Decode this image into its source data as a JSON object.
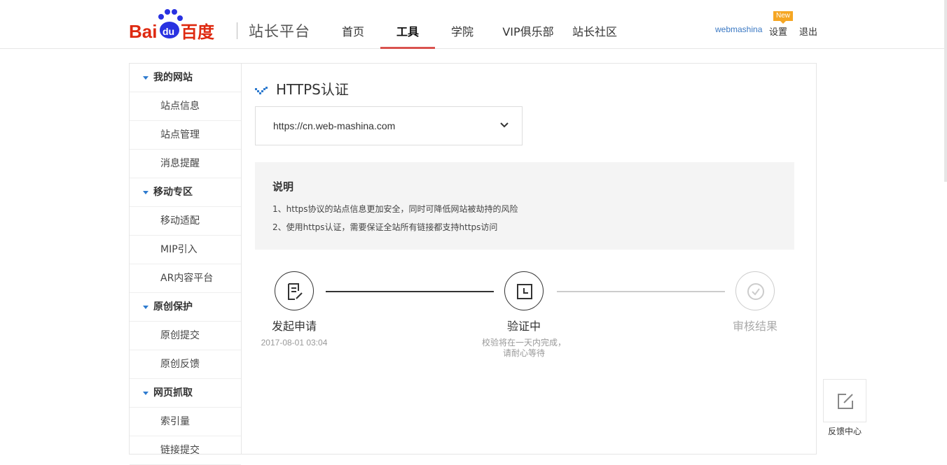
{
  "header": {
    "logo_text": "Bai du 百度",
    "site_title": "站长平台",
    "nav": [
      {
        "label": "首页",
        "active": false
      },
      {
        "label": "工具",
        "active": true
      },
      {
        "label": "学院",
        "active": false
      },
      {
        "label": "VIP俱乐部",
        "active": false
      },
      {
        "label": "站长社区",
        "active": false
      }
    ],
    "username": "webmashina",
    "settings_label": "设置",
    "new_badge": "New",
    "logout_label": "退出"
  },
  "sidebar": {
    "groups": [
      {
        "label": "我的网站",
        "items": [
          "站点信息",
          "站点管理",
          "消息提醒"
        ]
      },
      {
        "label": "移动专区",
        "items": [
          "移动适配",
          "MIP引入",
          "AR内容平台"
        ]
      },
      {
        "label": "原创保护",
        "items": [
          "原创提交",
          "原创反馈"
        ]
      },
      {
        "label": "网页抓取",
        "items": [
          "索引量",
          "链接提交"
        ]
      }
    ]
  },
  "main": {
    "title": "HTTPS认证",
    "site_select": {
      "value": "https://cn.web-mashina.com"
    },
    "note": {
      "title": "说明",
      "lines": [
        "1、https协议的站点信息更加安全，同时可降低网站被劫持的风险",
        "2、使用https认证，需要保证全站所有链接都支持https访问"
      ]
    },
    "steps": [
      {
        "label": "发起申请",
        "sub": "2017-08-01 03:04",
        "state": "done"
      },
      {
        "label": "验证中",
        "sub": "校验将在一天内完成，\n请耐心等待",
        "state": "current"
      },
      {
        "label": "审核结果",
        "sub": "",
        "state": "pending"
      }
    ]
  },
  "feedback": {
    "label": "反馈中心"
  },
  "colors": {
    "accent_red": "#d9534f",
    "link_blue": "#3a78c3",
    "badge_orange": "#f5a623",
    "logo_red": "#de2910",
    "logo_blue": "#2932e1"
  }
}
